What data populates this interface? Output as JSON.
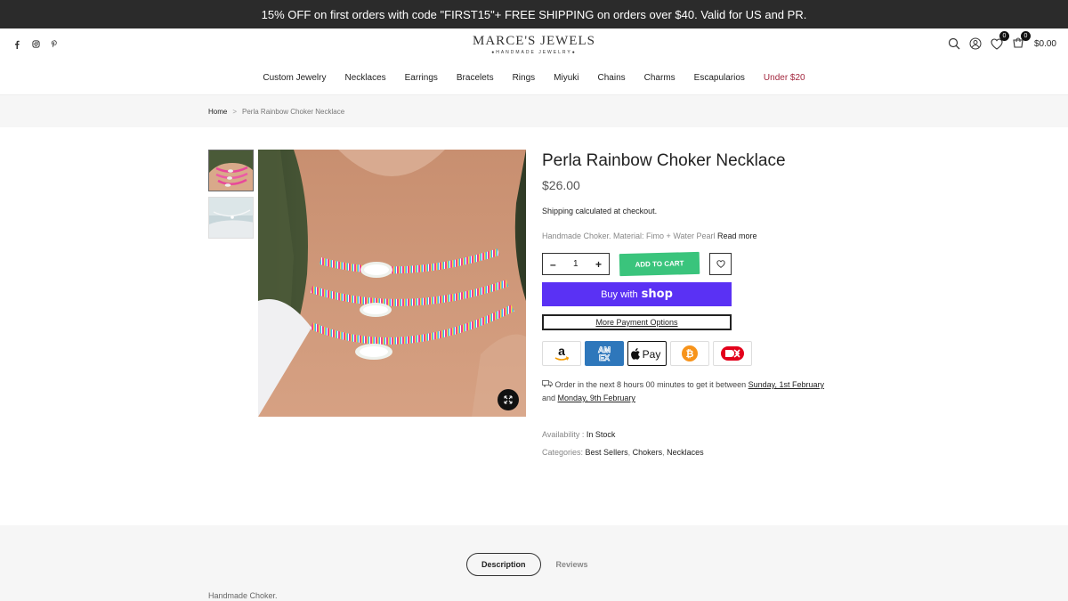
{
  "announcement": "15% OFF on first orders with code \"FIRST15\"+ FREE SHIPPING on orders over $40. Valid for US and PR.",
  "brand": {
    "name": "MARCE'S JEWELS",
    "tagline": "●HANDMADE JEWELRY●"
  },
  "header": {
    "wishlist_count": "0",
    "cart_count": "0",
    "cart_total": "$0.00"
  },
  "nav": [
    {
      "label": "Custom Jewelry"
    },
    {
      "label": "Necklaces"
    },
    {
      "label": "Earrings"
    },
    {
      "label": "Bracelets"
    },
    {
      "label": "Rings"
    },
    {
      "label": "Miyuki"
    },
    {
      "label": "Chains"
    },
    {
      "label": "Charms"
    },
    {
      "label": "Escapularios"
    },
    {
      "label": "Under $20"
    }
  ],
  "breadcrumb": {
    "home": "Home",
    "sep": ">",
    "current": "Perla Rainbow Choker Necklace"
  },
  "product": {
    "title": "Perla Rainbow Choker Necklace",
    "price": "$26.00",
    "shipping": "Shipping calculated at checkout.",
    "short_desc": "Handmade Choker. Material: Fimo + Water Pearl",
    "read_more": "Read more",
    "quantity": "1",
    "add_to_cart": "ADD TO CART",
    "buy_with": "Buy with",
    "shop": "shop",
    "more_payment": "More Payment Options",
    "order_prefix": "Order in the next 8 hours 00 minutes to get it between",
    "date1": "Sunday, 1st February",
    "and": "and",
    "date2": "Monday, 9th February",
    "availability_label": "Availability :",
    "availability_value": "In Stock",
    "categories_label": "Categories:",
    "categories": [
      "Best Sellers",
      "Chokers",
      "Necklaces"
    ]
  },
  "payment_methods": [
    "amazon",
    "amex",
    "apple-pay",
    "bitcoin",
    "dankort"
  ],
  "tabs": {
    "description": "Description",
    "reviews": "Reviews",
    "content": "Handmade Choker."
  },
  "colors": {
    "shop_purple": "#5a31f4",
    "cart_green": "#3ac47c",
    "sale_red": "#a3273e",
    "announce_bg": "#2b2b2b"
  }
}
